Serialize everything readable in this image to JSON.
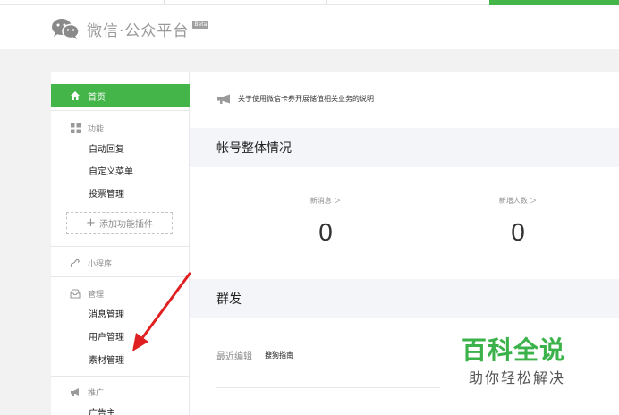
{
  "header": {
    "logo_text": "微信·公众平台",
    "beta_label": "Beta"
  },
  "sidebar": {
    "home_label": "首页",
    "features": {
      "head": "功能",
      "items": [
        "自动回复",
        "自定义菜单",
        "投票管理"
      ],
      "add_plugin": "添加功能插件"
    },
    "mini_program": "小程序",
    "management": {
      "head": "管理",
      "items": [
        "消息管理",
        "用户管理",
        "素材管理"
      ]
    },
    "promotion": {
      "head": "推广",
      "items": [
        "广告主"
      ]
    }
  },
  "main": {
    "notice": "关于使用微信卡券开展储值相关业务的说明",
    "account_overview_title": "帐号整体情况",
    "stats": [
      {
        "label": "新消息 ＞",
        "value": "0"
      },
      {
        "label": "新增人数 ＞",
        "value": "0"
      }
    ],
    "broadcast_title": "群发",
    "recent_edit_label": "最近编辑",
    "recent_edit_name": "搜狗指南"
  },
  "watermark": {
    "title": "百科全说",
    "subtitle": "助你轻松解决"
  },
  "colors": {
    "accent": "#44b549",
    "watermark_green": "#3bb34a",
    "arrow": "#e02020"
  }
}
